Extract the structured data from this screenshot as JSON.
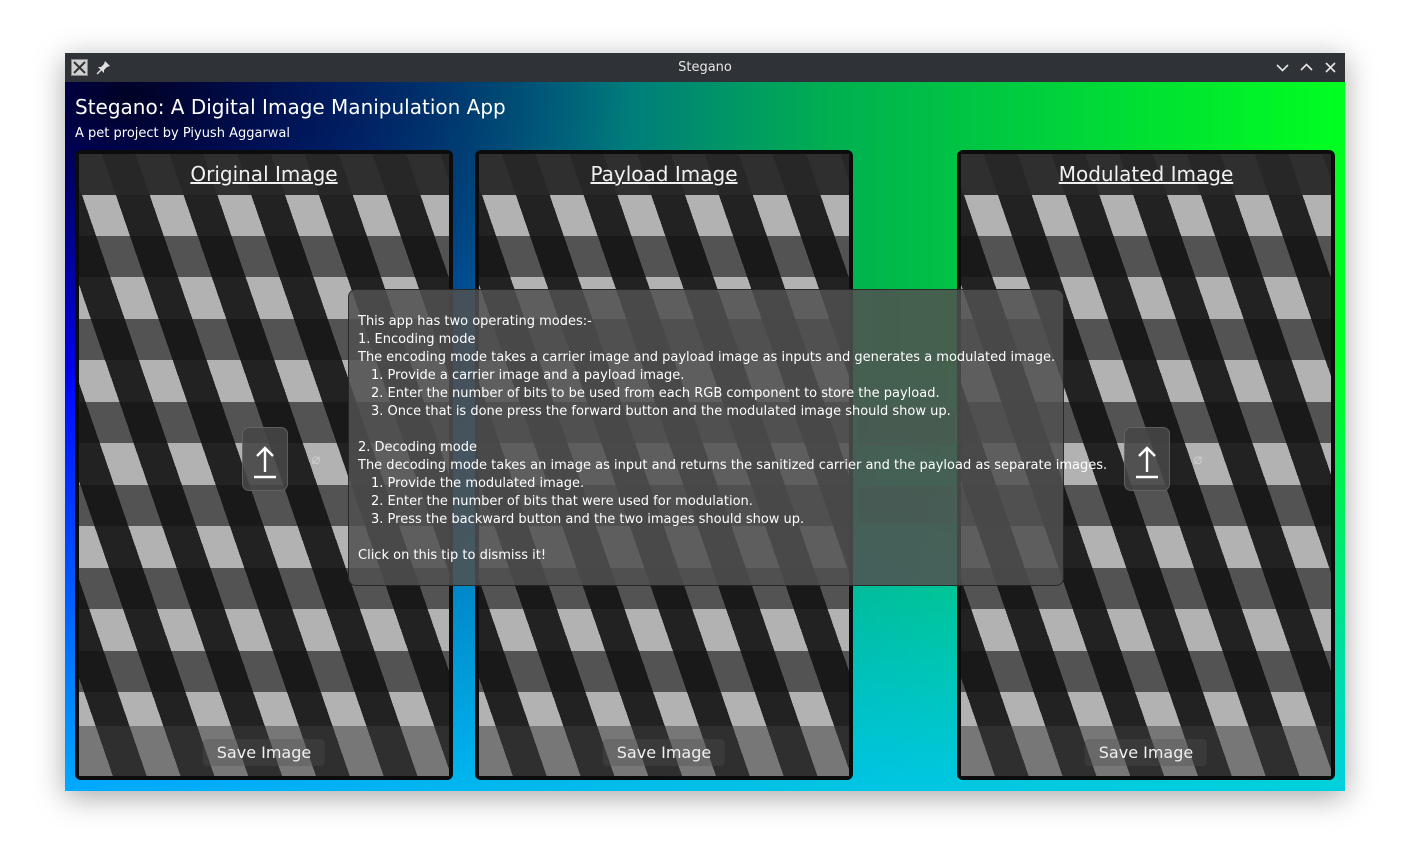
{
  "window": {
    "title": "Stegano"
  },
  "app": {
    "title": "Stegano: A Digital Image Manipulation App",
    "subtitle": "A pet project by Piyush Aggarwal"
  },
  "panels": [
    {
      "title": "Original Image",
      "save_label": "Save Image",
      "clear_symbol": "⌀"
    },
    {
      "title": "Payload Image",
      "save_label": "Save Image"
    },
    {
      "title": "Modulated Image",
      "save_label": "Save Image",
      "clear_symbol": "⌀"
    }
  ],
  "tip": {
    "lines": [
      "This app has two operating modes:-",
      "1. Encoding mode",
      "The encoding mode takes a carrier image and payload image as inputs and generates a modulated image.",
      "1. Provide a carrier image and a payload image.",
      "2. Enter the number of bits to be used from each RGB component to store the payload.",
      "3. Once that is done press the forward button and the modulated image should show up.",
      "",
      "2. Decoding mode",
      "The decoding mode takes an image as input and returns the sanitized carrier and the payload as separate images.",
      "1. Provide the modulated image.",
      "2. Enter the number of bits that were used for modulation.",
      "3. Press the backward button and the two images should show up.",
      "",
      "Click on this tip to dismiss it!"
    ]
  },
  "icons": {
    "app": "app-icon",
    "pin": "pin-icon",
    "minimize": "chevron-down-icon",
    "maximize": "chevron-up-icon",
    "close": "close-icon",
    "upload": "upload-icon"
  },
  "colors": {
    "titlebar": "#2f3236",
    "panel_bg": "#0c0c0c",
    "gradient_left": "#0000ff",
    "gradient_right": "#00ff20"
  }
}
